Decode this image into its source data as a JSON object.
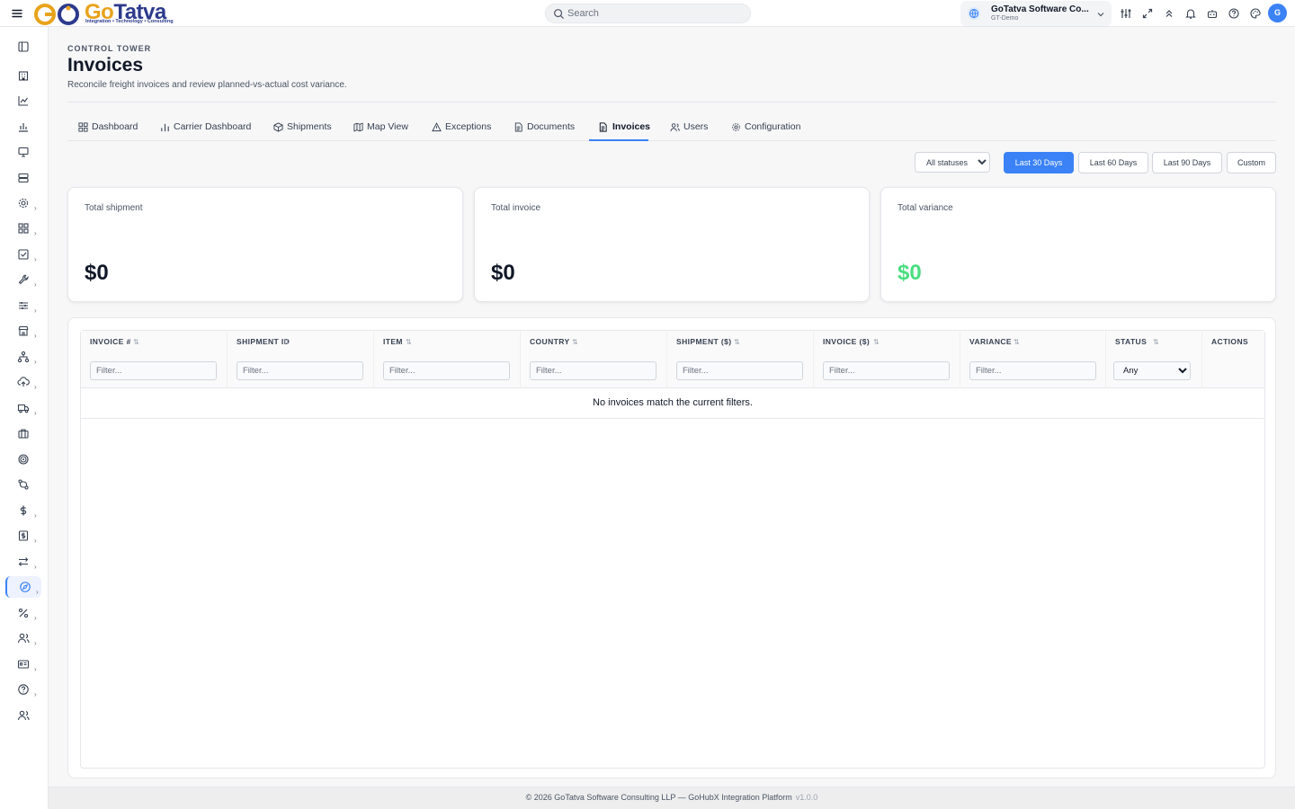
{
  "brand": {
    "name_part1": "Go",
    "name_part2": "Tatva",
    "tagline": "Integration • Technology • Consulting"
  },
  "search": {
    "placeholder": "Search"
  },
  "org": {
    "name": "GoTatva Software Co...",
    "sub": "GT-Demo"
  },
  "user": {
    "initial": "G"
  },
  "toolbar_icons": [
    "sliders-icon",
    "expand-icon",
    "chevrons-up-icon",
    "bell-icon",
    "robot-icon",
    "help-icon",
    "palette-icon"
  ],
  "sidebar": {
    "items": [
      {
        "icon": "panel-toggle-icon"
      },
      {
        "icon": "building-icon"
      },
      {
        "icon": "line-chart-icon"
      },
      {
        "icon": "bar-chart-icon"
      },
      {
        "icon": "monitor-icon"
      },
      {
        "icon": "server-icon"
      },
      {
        "icon": "settings-icon"
      },
      {
        "icon": "grid-icon"
      },
      {
        "icon": "checkbox-icon"
      },
      {
        "icon": "wrench-icon"
      },
      {
        "icon": "sliders-icon"
      },
      {
        "icon": "store-icon"
      },
      {
        "icon": "network-icon"
      },
      {
        "icon": "upload-cloud-icon"
      },
      {
        "icon": "truck-icon"
      },
      {
        "icon": "briefcase-icon"
      },
      {
        "icon": "target-icon"
      },
      {
        "icon": "git-compare-icon"
      },
      {
        "icon": "dollar-icon"
      },
      {
        "icon": "receipt-icon"
      },
      {
        "icon": "arrows-exchange-icon"
      },
      {
        "icon": "compass-icon"
      },
      {
        "icon": "percent-icon"
      },
      {
        "icon": "users-icon"
      },
      {
        "icon": "id-card-icon"
      },
      {
        "icon": "help-circle-icon"
      },
      {
        "icon": "team-icon"
      }
    ]
  },
  "page": {
    "eyebrow": "CONTROL TOWER",
    "title": "Invoices",
    "subtitle": "Reconcile freight invoices and review planned-vs-actual cost variance."
  },
  "tabs": [
    {
      "label": "Dashboard",
      "icon": "dashboard-icon"
    },
    {
      "label": "Carrier Dashboard",
      "icon": "bar-chart-icon"
    },
    {
      "label": "Shipments",
      "icon": "package-icon"
    },
    {
      "label": "Map View",
      "icon": "map-icon"
    },
    {
      "label": "Exceptions",
      "icon": "alert-triangle-icon"
    },
    {
      "label": "Documents",
      "icon": "document-icon"
    },
    {
      "label": "Invoices",
      "icon": "invoice-icon",
      "active": true
    },
    {
      "label": "Users",
      "icon": "users-icon"
    },
    {
      "label": "Configuration",
      "icon": "settings-icon"
    }
  ],
  "filters": {
    "status_selected": "All statuses",
    "ranges": [
      "Last 30 Days",
      "Last 60 Days",
      "Last 90 Days",
      "Custom"
    ],
    "active_range": "Last 30 Days"
  },
  "cards": [
    {
      "label": "Total shipment",
      "value": "$0"
    },
    {
      "label": "Total invoice",
      "value": "$0"
    },
    {
      "label": "Total variance",
      "value": "$0"
    }
  ],
  "table": {
    "columns": [
      "INVOICE #",
      "SHIPMENT ID",
      "ITEM",
      "COUNTRY",
      "SHIPMENT ($)",
      "INVOICE ($)",
      "VARIANCE",
      "STATUS",
      "ACTIONS"
    ],
    "filter_placeholder": "Filter...",
    "status_filter_value": "Any",
    "empty_message": "No invoices match the current filters."
  },
  "footer": {
    "text": "© 2026 GoTatva Software Consulting LLP — GoHubX Integration Platform",
    "version": "v1.0.0"
  },
  "colors": {
    "accent": "#3b82f6",
    "brand_orange": "#e8a31c",
    "brand_navy": "#2c3a8c",
    "variance_positive": "#4ade80"
  }
}
